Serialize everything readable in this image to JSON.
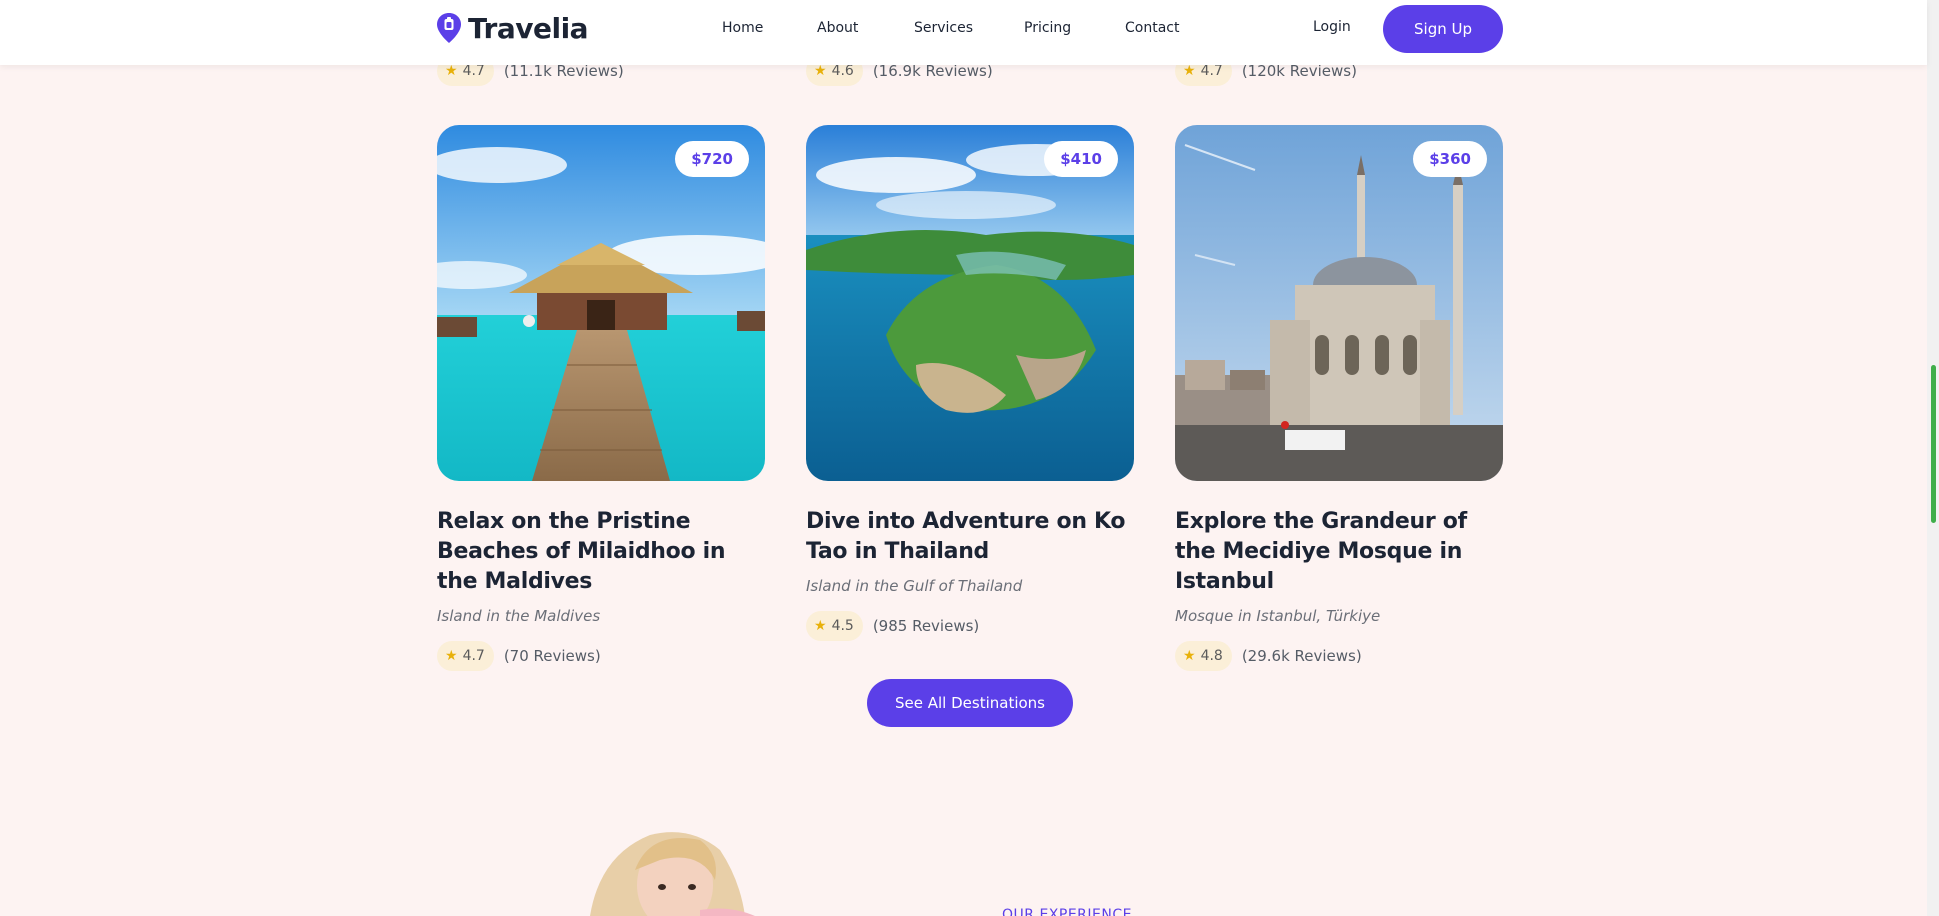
{
  "brand": {
    "name": "Travelia",
    "accent": "#5b3fe8"
  },
  "nav": {
    "items": [
      "Home",
      "About",
      "Services",
      "Pricing",
      "Contact"
    ],
    "login": "Login",
    "signup": "Sign Up"
  },
  "top_ratings": [
    {
      "rating": "4.7",
      "reviews": "(11.1k Reviews)"
    },
    {
      "rating": "4.6",
      "reviews": "(16.9k Reviews)"
    },
    {
      "rating": "4.7",
      "reviews": "(120k Reviews)"
    }
  ],
  "cards": [
    {
      "price": "$720",
      "title": "Relax on the Pristine Beaches of Milaidhoo in the Maldives",
      "subtitle": "Island in the Maldives",
      "rating": "4.7",
      "reviews": "(70 Reviews)"
    },
    {
      "price": "$410",
      "title": "Dive into Adventure on Ko Tao in Thailand",
      "subtitle": "Island in the Gulf of Thailand",
      "rating": "4.5",
      "reviews": "(985 Reviews)"
    },
    {
      "price": "$360",
      "title": "Explore the Grandeur of the Mecidiye Mosque in Istanbul",
      "subtitle": "Mosque in Istanbul, Türkiye",
      "rating": "4.8",
      "reviews": "(29.6k Reviews)"
    }
  ],
  "see_all": "See All Destinations",
  "experience": {
    "label": "OUR EXPERIENCE"
  },
  "icons": {
    "logo": "location-pin-icon",
    "rating": "star-icon"
  }
}
